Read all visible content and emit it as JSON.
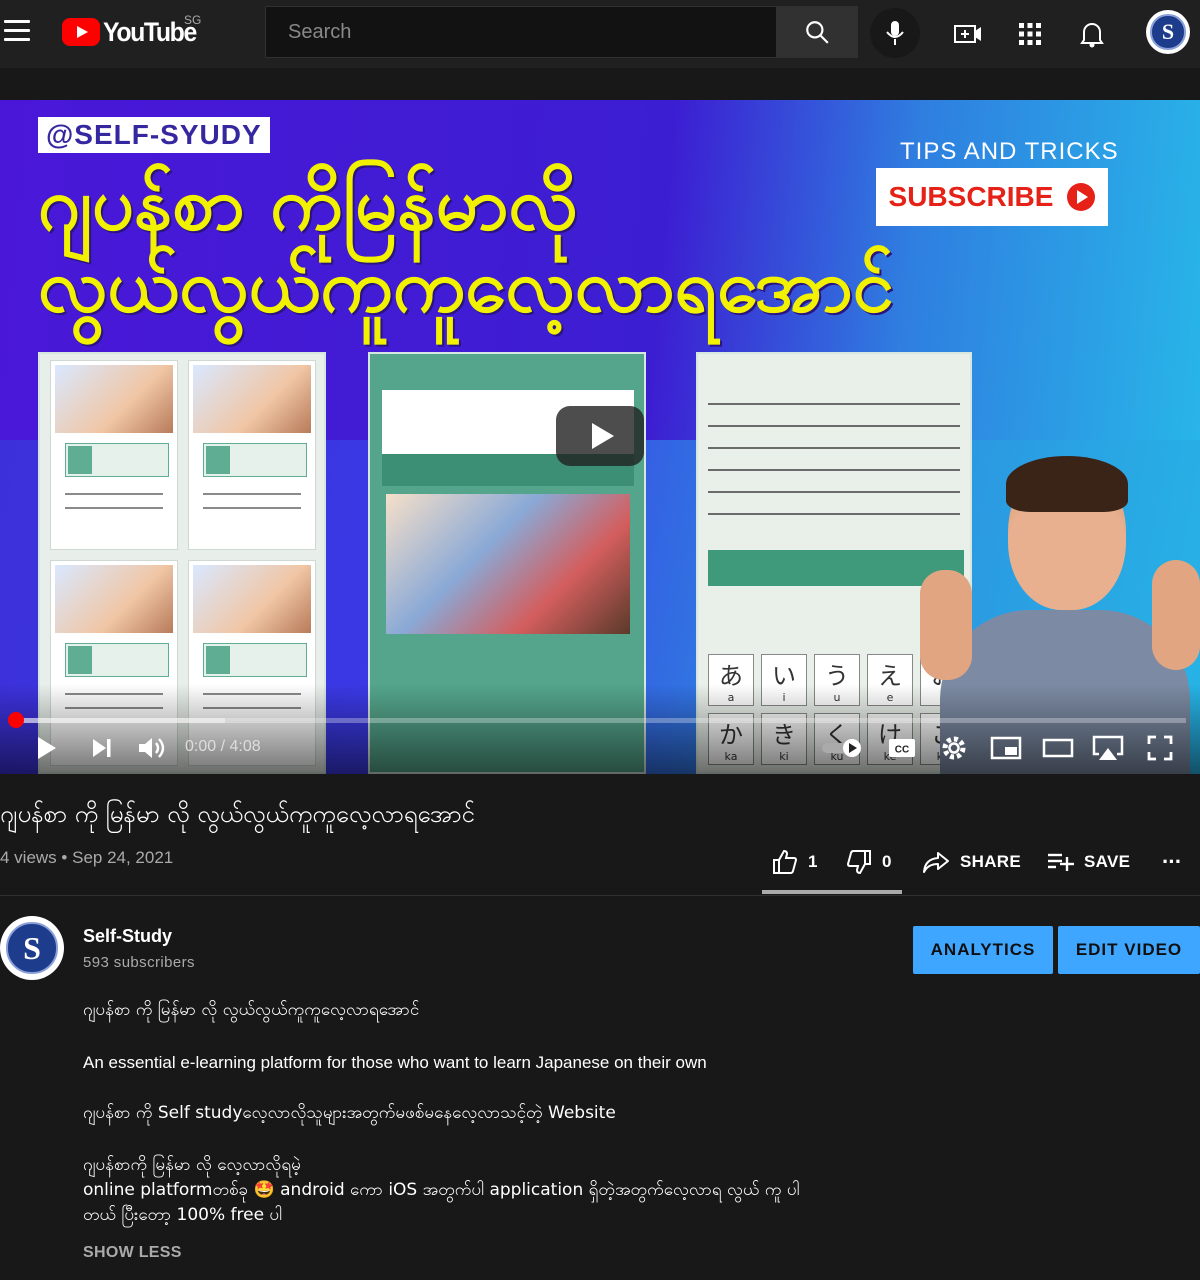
{
  "header": {
    "logo_text": "YouTube",
    "region": "SG",
    "search_placeholder": "Search"
  },
  "player": {
    "thumbnail": {
      "channel_tag": "@SELF-SYUDY",
      "title_line1": "ဂျပန်စာ ကိုမြန်မာလို",
      "title_line2": "လွယ်လွယ်ကူကူလေ့လာရအောင်",
      "tips": "TIPS AND TRICKS",
      "subscribe": "SUBSCRIBE",
      "kana": [
        {
          "k": "あ",
          "r": "a"
        },
        {
          "k": "い",
          "r": "i"
        },
        {
          "k": "う",
          "r": "u"
        },
        {
          "k": "え",
          "r": "e"
        },
        {
          "k": "お",
          "r": "o"
        },
        {
          "k": "か",
          "r": "ka"
        },
        {
          "k": "き",
          "r": "ki"
        },
        {
          "k": "く",
          "r": "ku"
        },
        {
          "k": "け",
          "r": "ke"
        },
        {
          "k": "こ",
          "r": "ko"
        }
      ]
    },
    "time_current": "0:00",
    "time_total": "4:08",
    "played_fraction": 0.0,
    "loaded_fraction": 0.18
  },
  "video": {
    "title": "ဂျပန်စာ ကို မြန်မာ လို လွယ်လွယ်ကူကူလေ့လာရအောင်",
    "views": "4 views",
    "separator": "•",
    "date": "Sep 24, 2021",
    "likes": "1",
    "dislikes": "0",
    "share_label": "SHARE",
    "save_label": "SAVE",
    "more_label": "..."
  },
  "channel": {
    "name": "Self-Study",
    "subscribers": "593 subscribers",
    "analytics_label": "ANALYTICS",
    "edit_label": "EDIT VIDEO"
  },
  "description": {
    "line1": "ဂျပန်စာ ကို မြန်မာ လို လွယ်လွယ်ကူကူလေ့လာရအောင်",
    "line2": "An essential e-learning platform for those who want to learn Japanese on their own",
    "line3": "ဂျပန်စာ ကို Self studyလေ့လာလိုသူများအတွက်မဖစ်မနေလေ့လာသင့်တဲ့ Website",
    "line4a": "ဂျပန်စာကို မြန်မာ လို လေ့လာလိုရမဲ့",
    "line4b": "online platformတစ်ခု 🤩 android ကော iOS အတွက်ပါ application ရှိတဲ့အတွက်လေ့လာရ လွယ် ကူ ပါ",
    "line4c": "တယ် ပြီးတော့ 100% free ပါ",
    "show_less": "SHOW LESS"
  },
  "colors": {
    "accent_blue": "#3ea6ff",
    "youtube_red": "#ff0000",
    "background": "#181818"
  }
}
